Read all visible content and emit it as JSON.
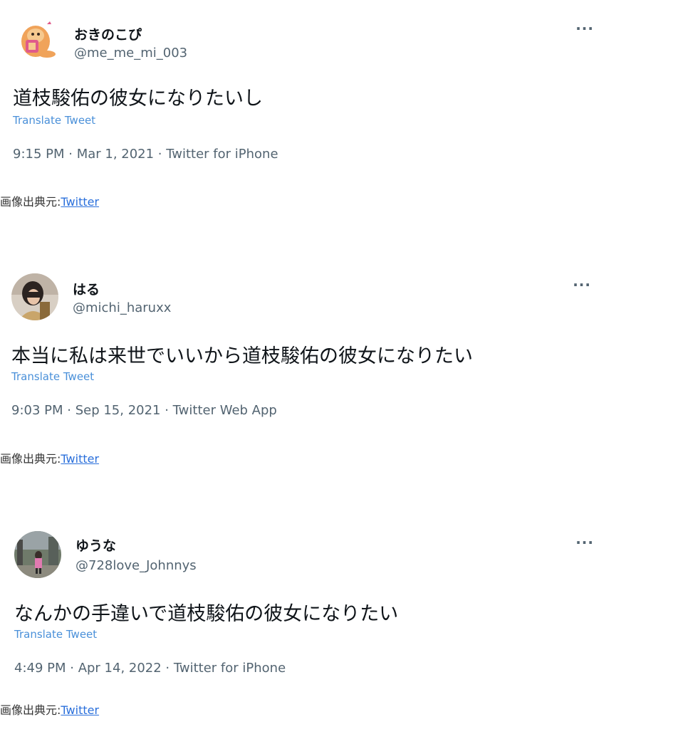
{
  "tweets": [
    {
      "name": "おきのこぴ",
      "handle": "@me_me_mi_003",
      "more": "···",
      "text": "道枝駿佑の彼女になりたいし",
      "translate": "Translate Tweet",
      "meta": "9:15 PM · Mar 1, 2021 · Twitter for iPhone",
      "source_label": "画像出典元:",
      "source_link": "Twitter"
    },
    {
      "name": "はる",
      "handle": "@michi_haruxx",
      "more": "···",
      "text": "本当に私は来世でいいから道枝駿佑の彼女になりたい",
      "translate": "Translate Tweet",
      "meta": "9:03 PM · Sep 15, 2021 · Twitter Web App",
      "source_label": "画像出典元:",
      "source_link": "Twitter"
    },
    {
      "name": "ゆうな",
      "handle": "@728love_Johnnys",
      "more": "···",
      "text": "なんかの手違いで道枝駿佑の彼女になりたい",
      "translate": "Translate Tweet",
      "meta": "4:49 PM · Apr 14, 2022 · Twitter for iPhone",
      "source_label": "画像出典元:",
      "source_link": "Twitter"
    }
  ],
  "icons": {
    "more": "more-options-icon",
    "avatar1": "cartoon-character-avatar",
    "avatar2": "person-photo-avatar",
    "avatar3": "street-photo-avatar"
  },
  "colors": {
    "text": "#0f1419",
    "secondary": "#536471",
    "translate": "#4a90d9",
    "link": "#2a6fdb"
  }
}
